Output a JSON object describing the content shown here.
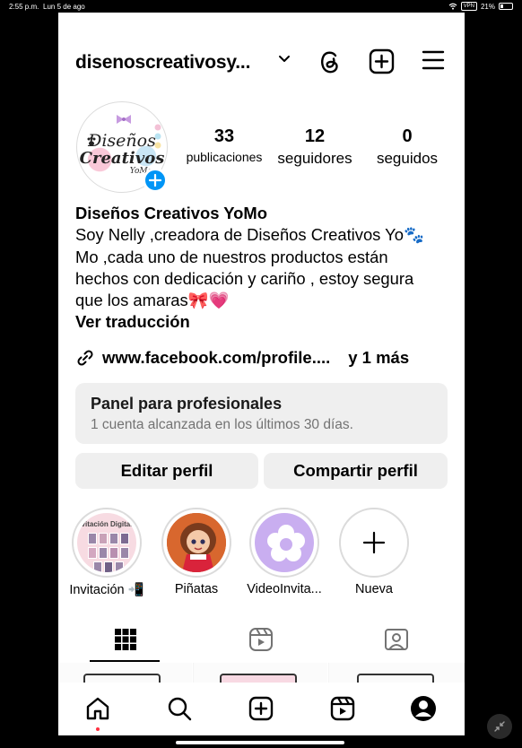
{
  "status_bar": {
    "time": "2:55 p.m.",
    "date": "Lun 5 de ago",
    "vpn": "VPN",
    "battery": "21%",
    "battery_level": 0.21
  },
  "header": {
    "username": "disenoscreativosy..."
  },
  "profile": {
    "avatar_logo": {
      "line1": "Diseños",
      "line2": "Creativos",
      "line3": "YoMo"
    },
    "stats": [
      {
        "value": "33",
        "label": "publicaciones"
      },
      {
        "value": "12",
        "label": "seguidores"
      },
      {
        "value": "0",
        "label": "seguidos"
      }
    ],
    "display_name": "Diseños Creativos YoMo",
    "bio_lines": [
      "Soy Nelly ,creadora de Diseños Creativos Yo🐾",
      "Mo ,cada uno de nuestros productos están",
      "hechos con dedicación y cariño , estoy segura",
      "que los amaras🎀💗"
    ],
    "translate": "Ver traducción",
    "link": "www.facebook.com/profile....",
    "link_more": "y 1 más"
  },
  "pro_panel": {
    "title": "Panel para profesionales",
    "subtitle": "1 cuenta alcanzada en los últimos 30 días."
  },
  "buttons": {
    "edit": "Editar perfil",
    "share": "Compartir perfil"
  },
  "highlights": [
    {
      "label": "Invitación 📲",
      "cover_text": "vitación Digital"
    },
    {
      "label": "Piñatas"
    },
    {
      "label": "VideoInvita..."
    },
    {
      "label": "Nueva"
    }
  ],
  "tabs": [
    {
      "icon": "grid-icon",
      "active": true
    },
    {
      "icon": "reels-icon",
      "active": false
    },
    {
      "icon": "tagged-icon",
      "active": false
    }
  ],
  "bottom_nav": [
    {
      "icon": "home-icon",
      "active": true
    },
    {
      "icon": "search-icon"
    },
    {
      "icon": "create-icon"
    },
    {
      "icon": "reels-icon"
    },
    {
      "icon": "profile-icon"
    }
  ],
  "colors": {
    "accent": "#0095f6",
    "panel_bg": "#efefef",
    "notification_dot": "#ff3040"
  }
}
